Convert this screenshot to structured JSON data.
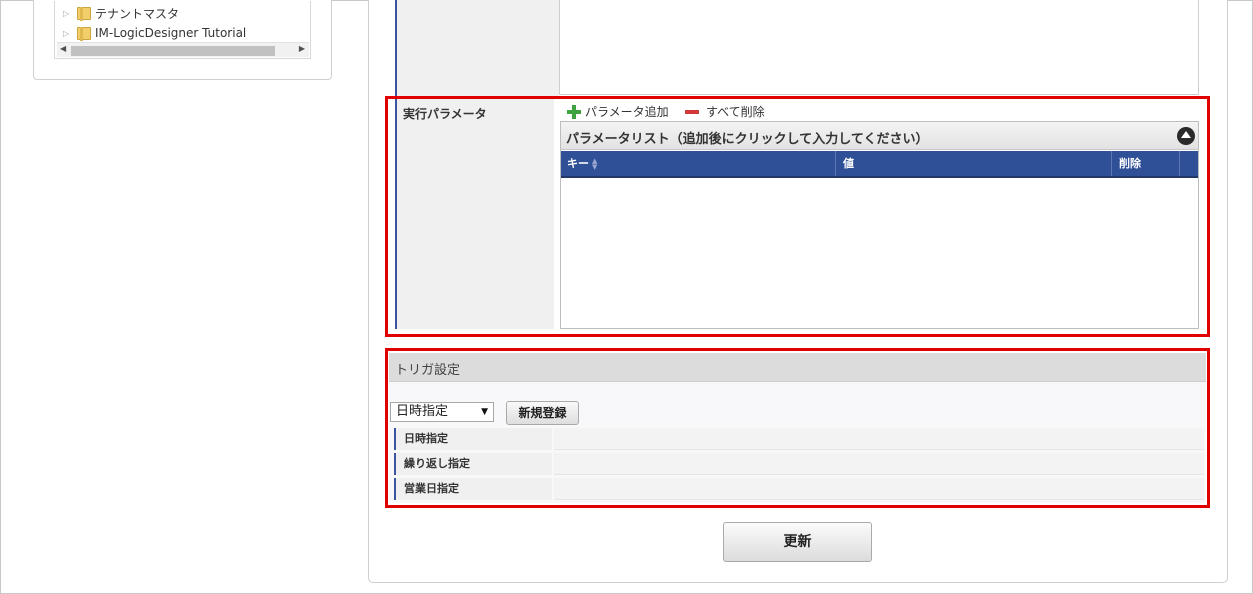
{
  "tree": {
    "items": [
      {
        "label": "テナントマスタ"
      },
      {
        "label": "IM-LogicDesigner Tutorial"
      }
    ]
  },
  "params": {
    "label": "実行パラメータ",
    "add_label": "パラメータ追加",
    "delete_all_label": "すべて削除",
    "grid_caption": "パラメータリスト（追加後にクリックして入力してください）",
    "columns": [
      "キー",
      "値",
      "削除"
    ],
    "rows": []
  },
  "trigger": {
    "title": "トリガ設定",
    "select_value": "日時指定",
    "new_button": "新規登録",
    "rows": [
      {
        "label": "日時指定"
      },
      {
        "label": "繰り返し指定"
      },
      {
        "label": "営業日指定"
      }
    ]
  },
  "update_button": "更新",
  "colors": {
    "highlight": "#e00000",
    "grid_header": "#2f4f97",
    "label_accent": "#3a55a0"
  }
}
